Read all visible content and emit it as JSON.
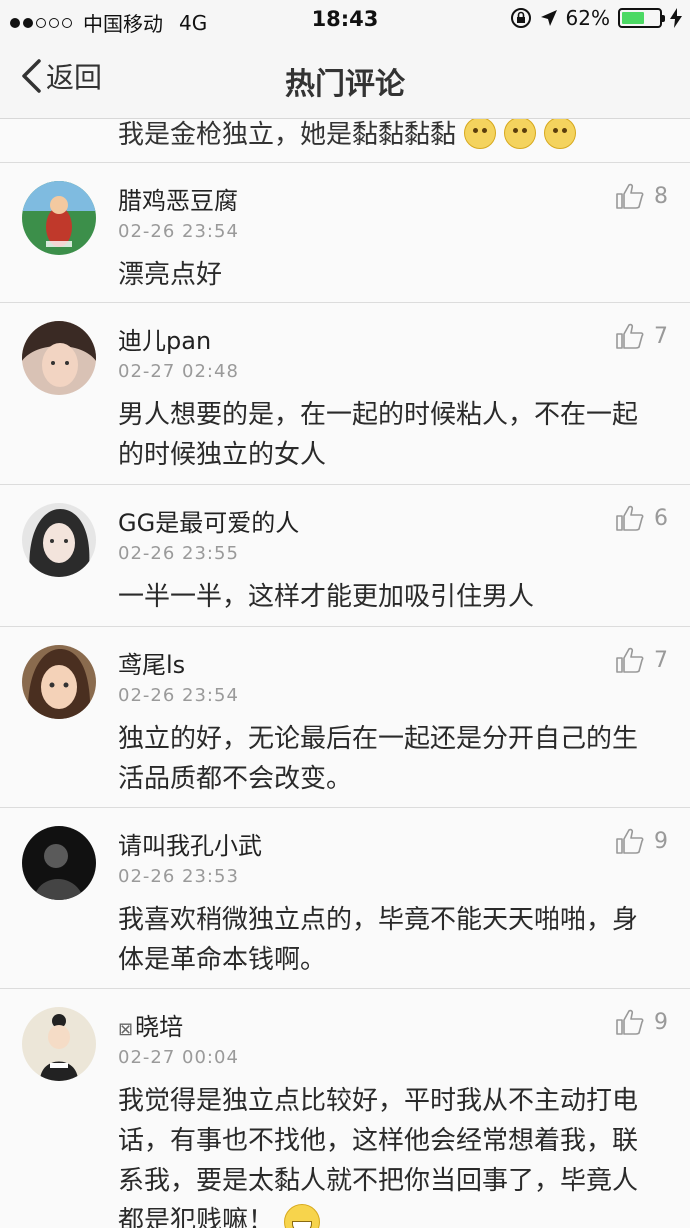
{
  "status_bar": {
    "carrier": "中国移动",
    "network": "4G",
    "time": "18:43",
    "battery": "62%",
    "battery_level": 0.62,
    "icons": [
      "signal-dots-icon",
      "lock-rotation-icon",
      "location-arrow-icon",
      "battery-icon",
      "charging-bolt-icon"
    ]
  },
  "nav": {
    "back_label": "返回",
    "title": "热门评论"
  },
  "partial_comment": {
    "text": "我是金枪独立，她是黏黏黏黏"
  },
  "comments": [
    {
      "user": "腊鸡恶豆腐",
      "time": "02-26 23:54",
      "likes": "8",
      "text": "漂亮点好"
    },
    {
      "user": "迪儿pan",
      "time": "02-27 02:48",
      "likes": "7",
      "text": "男人想要的是，在一起的时候粘人，不在一起的时候独立的女人"
    },
    {
      "user": "GG是最可爱的人",
      "time": "02-26 23:55",
      "likes": "6",
      "text": "一半一半，这样才能更加吸引住男人"
    },
    {
      "user": "鸢尾ls",
      "time": "02-26 23:54",
      "likes": "7",
      "text": "独立的好，无论最后在一起还是分开自己的生活品质都不会改变。"
    },
    {
      "user": "请叫我孔小武",
      "time": "02-26 23:53",
      "likes": "9",
      "text": "我喜欢稍微独立点的，毕竟不能天天啪啪，身体是革命本钱啊。"
    },
    {
      "user": "晓培",
      "time": "02-27 00:04",
      "likes": "9",
      "text": "我觉得是独立点比较好，平时我从不主动打电话，有事也不找他，这样他会经常想着我，联系我，要是太黏人就不把你当回事了，毕竟人都是犯贱嘛！"
    }
  ],
  "colors": {
    "background": "#f7f7f7",
    "battery_green": "#4cd964",
    "timestamp_gray": "#9a9a9a"
  }
}
